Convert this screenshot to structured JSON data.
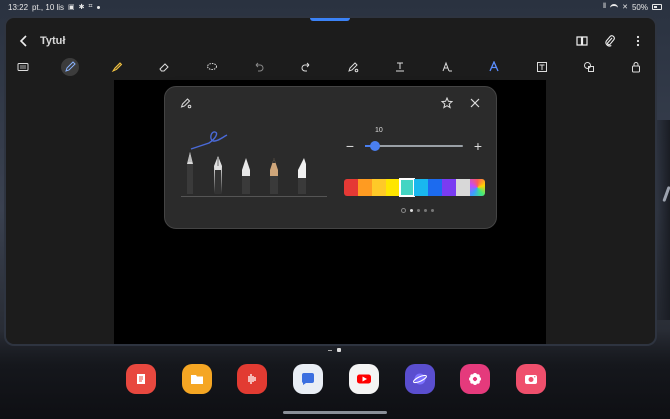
{
  "status_bar": {
    "time": "13:22",
    "date": "pt., 10 lis",
    "battery": "50%"
  },
  "note": {
    "title": "Tytuł"
  },
  "toolbar": {
    "tools": [
      "text-mode",
      "pen",
      "highlighter",
      "eraser",
      "lasso",
      "undo",
      "redo",
      "pen-settings",
      "text-format",
      "handwriting-to-text",
      "ink-style",
      "insert",
      "shapes",
      "lock"
    ]
  },
  "pen_settings": {
    "size_value": "10",
    "size_fraction": 0.1,
    "colors": [
      "#e53935",
      "#ff9b21",
      "#ffc928",
      "#ffe600",
      "#43d5c3",
      "#19b8ef",
      "#1c6bef",
      "#7a3cf2",
      "#d8d8d8"
    ],
    "selected_color": "#43d5c3",
    "page_count": 4,
    "active_page": 0
  },
  "dock": {
    "apps": [
      {
        "name": "notes-app",
        "color": "#e8483f"
      },
      {
        "name": "files-app",
        "color": "#f5a623"
      },
      {
        "name": "voice-recorder-app",
        "color": "#e23b32"
      },
      {
        "name": "messages-app",
        "color": "#e9eef5"
      },
      {
        "name": "youtube-app",
        "color": "#f4f4f4"
      },
      {
        "name": "internet-app",
        "color": "#5a4ecf"
      },
      {
        "name": "gallery-app",
        "color": "#e53a7c"
      },
      {
        "name": "camera-app",
        "color": "#ef4f6c"
      }
    ]
  }
}
